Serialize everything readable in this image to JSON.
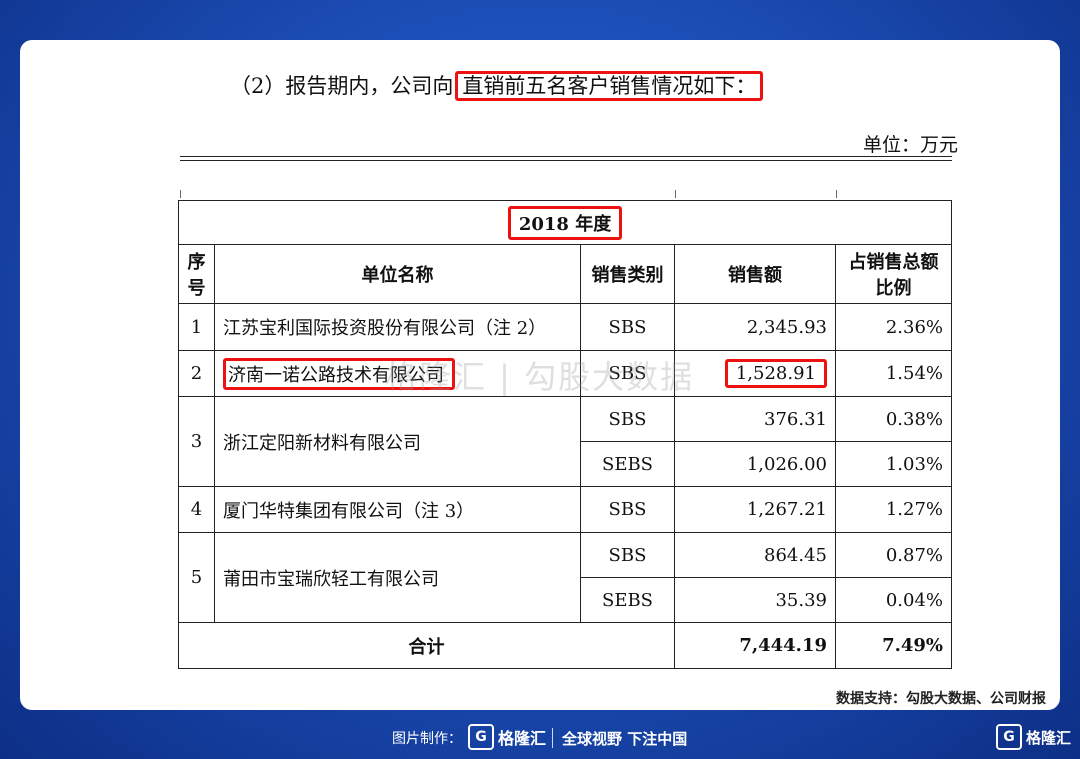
{
  "intro": {
    "prefix": "（2）报告期内，公司向",
    "highlight": "直销前五名客户销售情况如下："
  },
  "unit": "单位：万元",
  "table": {
    "year": "2018 年度",
    "headers": {
      "no_line1": "序",
      "no_line2": "号",
      "name": "单位名称",
      "category": "销售类别",
      "amount": "销售额",
      "ratio_line1": "占销售总额",
      "ratio_line2": "比例"
    },
    "rows": [
      {
        "no": "1",
        "name": "江苏宝利国际投资股份有限公司（注 2）",
        "category": "SBS",
        "amount": "2,345.93",
        "ratio": "2.36%"
      },
      {
        "no": "2",
        "name": "济南一诺公路技术有限公司",
        "category": "SBS",
        "amount": "1,528.91",
        "ratio": "1.54%"
      },
      {
        "no": "3",
        "name": "浙江定阳新材料有限公司",
        "category": "SBS",
        "amount": "376.31",
        "ratio": "0.38%"
      },
      {
        "category": "SEBS",
        "amount": "1,026.00",
        "ratio": "1.03%"
      },
      {
        "no": "4",
        "name": "厦门华特集团有限公司（注 3）",
        "category": "SBS",
        "amount": "1,267.21",
        "ratio": "1.27%"
      },
      {
        "no": "5",
        "name": "莆田市宝瑞欣轻工有限公司",
        "category": "SBS",
        "amount": "864.45",
        "ratio": "0.87%"
      },
      {
        "category": "SEBS",
        "amount": "35.39",
        "ratio": "0.04%"
      }
    ],
    "total": {
      "label": "合计",
      "amount": "7,444.19",
      "ratio": "7.49%"
    }
  },
  "watermark": "格隆汇 | 勾股大数据",
  "source": "数据支持：勾股大数据、公司财报",
  "footer": {
    "made_by": "图片制作：",
    "logo_text": "格隆汇",
    "slogan": "全球视野 下注中国",
    "logo2_text": "格隆汇",
    "colors": {
      "background": "#1c4fb8",
      "highlight": "#e11111"
    }
  }
}
